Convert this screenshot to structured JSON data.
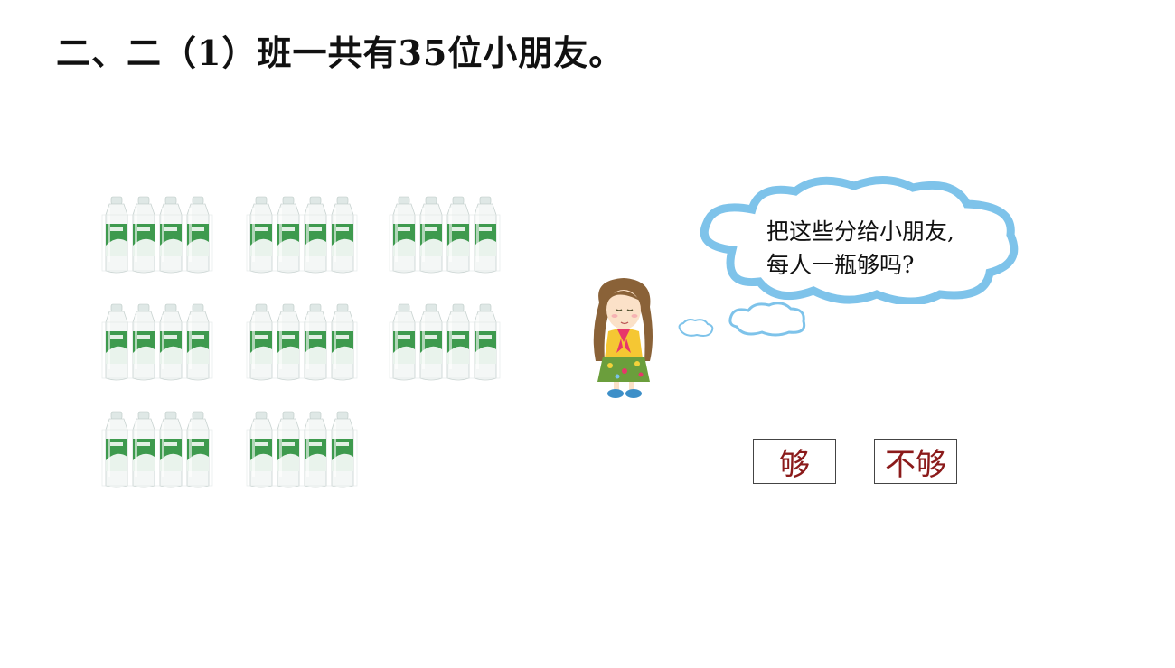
{
  "question": {
    "title": "二、二（1）班一共有35位小朋友。"
  },
  "illustration": {
    "bottle_packs": 8,
    "bottles_per_pack": 4,
    "bottle_label_color": "#3e9a4e"
  },
  "speech_bubble": {
    "line1": "把这些分给小朋友,",
    "line2": "每人一瓶够吗?"
  },
  "answers": {
    "enough": "够",
    "not_enough": "不够"
  },
  "colors": {
    "answer_text": "#8b1a1a",
    "cloud_outline": "#7ec3ea"
  }
}
